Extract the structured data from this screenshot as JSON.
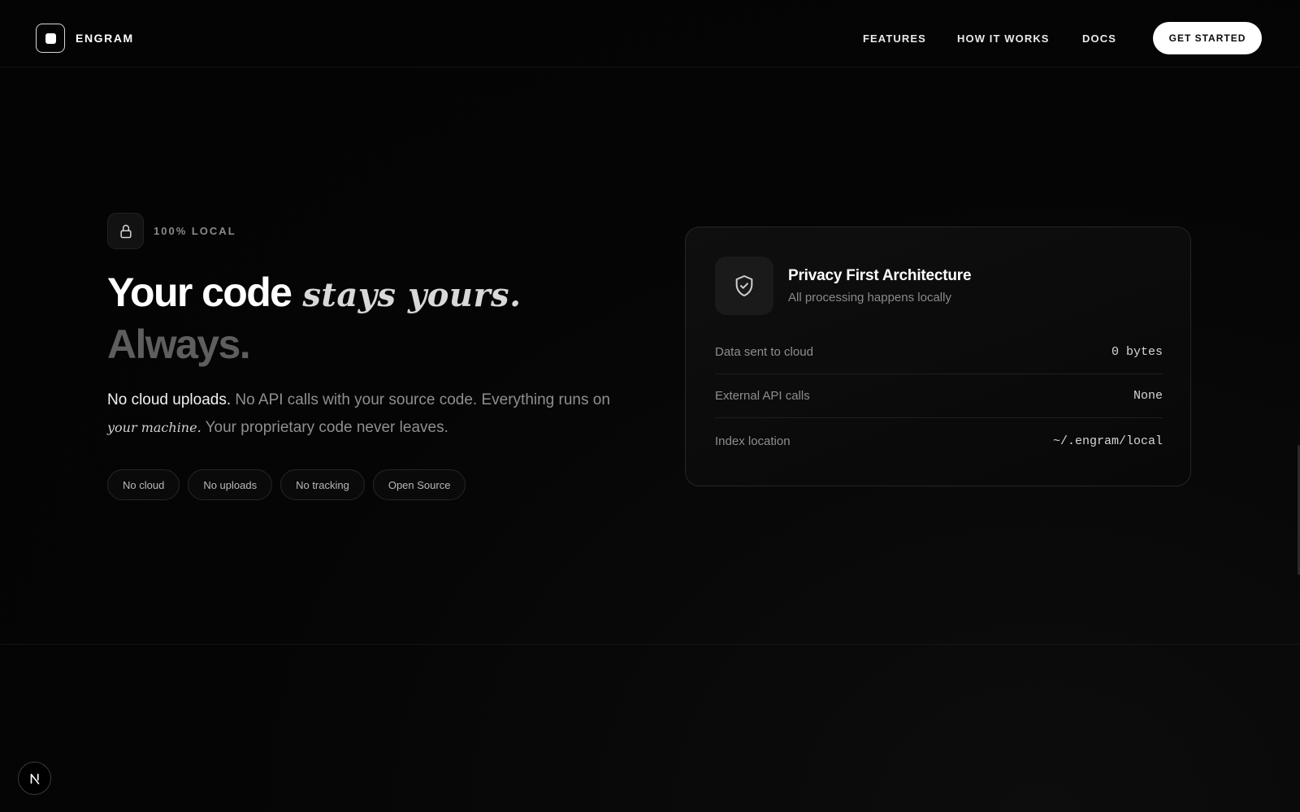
{
  "header": {
    "brand": "ENGRAM",
    "nav": [
      "FEATURES",
      "HOW IT WORKS",
      "DOCS"
    ],
    "cta": "GET STARTED"
  },
  "hero": {
    "badge": "100% LOCAL",
    "title_strong": "Your code",
    "title_script": "stays yours.",
    "title_muted": "Always.",
    "lede_highlight": "No cloud uploads.",
    "lede_rest_1": " No API calls with your source code. Everything runs on ",
    "lede_script": "your machine.",
    "lede_rest_2": " Your proprietary code never leaves.",
    "chips": [
      "No cloud",
      "No uploads",
      "No tracking",
      "Open Source"
    ]
  },
  "card": {
    "title": "Privacy First Architecture",
    "subtitle": "All processing happens locally",
    "rows": [
      {
        "label": "Data sent to cloud",
        "value": "0 bytes"
      },
      {
        "label": "External API calls",
        "value": "None"
      },
      {
        "label": "Index location",
        "value": "~/.engram/local"
      }
    ]
  },
  "icons": {
    "logo": "square-logo-icon",
    "badge": "lock-icon",
    "card": "shield-check-icon",
    "dev": "next-js-icon"
  },
  "colors": {
    "background": "#050505",
    "text_primary": "#ffffff",
    "text_muted": "#8f8f8f",
    "cta_bg": "#ffffff"
  }
}
